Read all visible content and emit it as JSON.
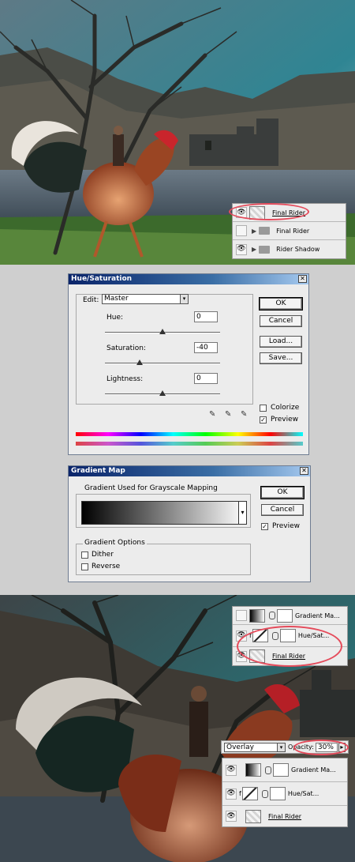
{
  "top_layers": {
    "rows": [
      {
        "name": "Final Rider",
        "visible": true,
        "icon": "eye-icon",
        "type": "layer",
        "underlined": true
      },
      {
        "name": "Final Rider",
        "visible": false,
        "icon": "",
        "type": "group"
      },
      {
        "name": "Rider Shadow",
        "visible": true,
        "icon": "eye-icon",
        "type": "group"
      }
    ]
  },
  "hue_saturation": {
    "title": "Hue/Saturation",
    "close": "✕",
    "edit_label": "Edit:",
    "edit_value": "Master",
    "hue_label": "Hue:",
    "hue_value": "0",
    "saturation_label": "Saturation:",
    "saturation_value": "-40",
    "lightness_label": "Lightness:",
    "lightness_value": "0",
    "ok": "OK",
    "cancel": "Cancel",
    "load": "Load...",
    "save": "Save...",
    "colorize_label": "Colorize",
    "colorize_checked": false,
    "preview_label": "Preview",
    "preview_checked": true,
    "check_mark": "✓"
  },
  "gradient_map": {
    "title": "Gradient Map",
    "close": "✕",
    "group_title": "Gradient Used for Grayscale Mapping",
    "ok": "OK",
    "cancel": "Cancel",
    "preview_label": "Preview",
    "preview_checked": true,
    "options_title": "Gradient Options",
    "dither_label": "Dither",
    "reverse_label": "Reverse",
    "check_mark": "✓"
  },
  "mid_layers": {
    "rows": [
      {
        "name": "Gradient Ma...",
        "visible": false
      },
      {
        "name": "Hue/Sat...",
        "visible": true
      },
      {
        "name": "Final Rider",
        "visible": true
      }
    ]
  },
  "bottom_layers": {
    "blend_mode": "Overlay",
    "opacity_label": "Opacity:",
    "opacity_value": "30%",
    "rows": [
      {
        "name": "Gradient Ma...",
        "visible": true
      },
      {
        "name": "Hue/Sat...",
        "visible": true
      },
      {
        "name": "Final Rider",
        "visible": true
      }
    ]
  },
  "icons": {
    "eye": "👁",
    "triangle": "▶",
    "chevron": "▾",
    "dropper": "✎",
    "fx": "f",
    "play": "▸"
  },
  "colors": {
    "highlight_oval": "#e54b5b",
    "title_bar": "#0a246a"
  }
}
